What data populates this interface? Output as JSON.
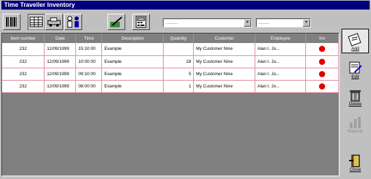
{
  "window": {
    "title": "Time Traveller Inventory"
  },
  "toolbar": {
    "buttons": [
      {
        "icon": "barcode-icon"
      },
      {
        "icon": "grid-view-icon"
      },
      {
        "icon": "vehicle-icon"
      },
      {
        "icon": "people-icon"
      },
      {
        "icon": "chart-icon"
      },
      {
        "icon": "pen-icon"
      },
      {
        "icon": "calculator-icon"
      }
    ],
    "filter1": {
      "value": "........."
    },
    "filter2": {
      "value": "........"
    }
  },
  "grid": {
    "columns": [
      "Item number",
      "Date",
      "Time",
      "Description",
      "Quantity",
      "Customer",
      "Employee",
      "Inv"
    ],
    "rows": [
      {
        "item": "232",
        "date": "12/09/1999",
        "time": "15:10:00",
        "desc": "Example",
        "qty": "",
        "customer": "My Customer Nine",
        "employee": "Alan I. Jo..."
      },
      {
        "item": "232",
        "date": "12/09/1999",
        "time": "10:00:00",
        "desc": "Example",
        "qty": "28",
        "customer": "My Customer Nine",
        "employee": "Alan I. Jo..."
      },
      {
        "item": "232",
        "date": "12/09/1999",
        "time": "09:10:00",
        "desc": "Example",
        "qty": "5",
        "customer": "My Customer Nine",
        "employee": "Alan I. Jo..."
      },
      {
        "item": "232",
        "date": "12/09/1999",
        "time": "08:00:00",
        "desc": "Example",
        "qty": "1",
        "customer": "My Customer Nine",
        "employee": "Alan I. Jo..."
      }
    ],
    "status_color": "#e00000"
  },
  "sidebar": {
    "add": "Add",
    "edit": "Edit",
    "delete": "Delete",
    "reports": "Reports",
    "close": "Close"
  }
}
